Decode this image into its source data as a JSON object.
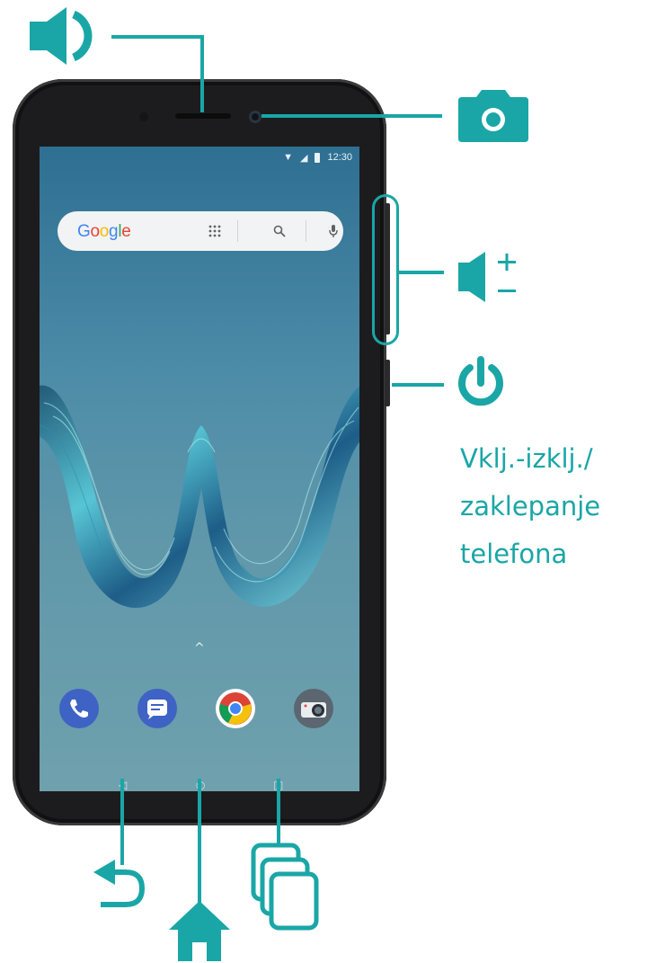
{
  "status_bar": {
    "time": "12:30"
  },
  "search_bar": {
    "logo_letters": [
      "G",
      "o",
      "o",
      "g",
      "l",
      "e"
    ]
  },
  "dock": [
    "phone-icon",
    "messages-icon",
    "chrome-icon",
    "camera-app-icon"
  ],
  "nav_buttons": [
    "back",
    "home",
    "recents"
  ],
  "callouts": {
    "speaker": "speaker-icon",
    "front_camera": "camera-icon",
    "volume": "volume-up-down-icon",
    "power": "power-icon",
    "back": "back-arrow-icon",
    "home": "home-icon",
    "recents": "recent-apps-icon"
  },
  "power_label": {
    "line1": "Vklj.-izklj./",
    "line2": "zaklepanje",
    "line3": "telefona"
  },
  "colors": {
    "accent": "#1aa6a6",
    "phone_body": "#1c1c1e",
    "screen_top": "#2e6f92",
    "screen_bottom": "#6fa1ad"
  }
}
